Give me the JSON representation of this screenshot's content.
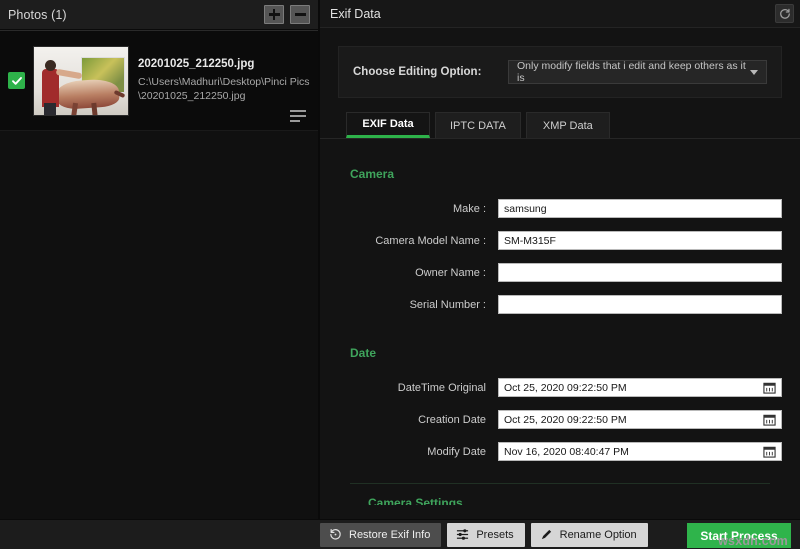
{
  "left_panel": {
    "title": "Photos (1)",
    "add_button": "add-photos-button",
    "remove_button": "remove-photos-button",
    "photo": {
      "name": "20201025_212250.jpg",
      "path": "C:\\Users\\Madhuri\\Desktop\\Pinci Pics\\20201025_212250.jpg",
      "checked": true
    }
  },
  "right_panel": {
    "title": "Exif Data",
    "refresh_icon": "refresh-icon",
    "editing_option": {
      "label": "Choose Editing Option:",
      "value": "Only modify fields that i edit and keep others as it is"
    },
    "tabs": [
      {
        "label": "EXIF Data",
        "active": true
      },
      {
        "label": "IPTC DATA",
        "active": false
      },
      {
        "label": "XMP Data",
        "active": false
      }
    ],
    "sections": [
      {
        "title": "Camera",
        "fields": [
          {
            "label": "Make :",
            "value": "samsung",
            "type": "text"
          },
          {
            "label": "Camera Model Name :",
            "value": "SM-M315F",
            "type": "text"
          },
          {
            "label": "Owner Name :",
            "value": "",
            "type": "text"
          },
          {
            "label": "Serial Number :",
            "value": "",
            "type": "text"
          }
        ]
      },
      {
        "title": "Date",
        "fields": [
          {
            "label": "DateTime Original",
            "value": "Oct 25, 2020 09:22:50 PM",
            "type": "date"
          },
          {
            "label": "Creation Date",
            "value": "Oct 25, 2020 09:22:50 PM",
            "type": "date"
          },
          {
            "label": "Modify Date",
            "value": "Nov 16, 2020 08:40:47 PM",
            "type": "date"
          }
        ]
      }
    ],
    "next_section_partial": "Camera Settings"
  },
  "bottom_bar": {
    "restore_exif_info": "Restore Exif Info",
    "presets": "Presets",
    "rename_option": "Rename Option",
    "start_process": "Start Process"
  },
  "watermark": "wsxdn.com",
  "colors": {
    "accent_green": "#2eb24a",
    "section_green": "#3fa45c",
    "panel_bg": "#131313",
    "input_bg": "#ffffff"
  }
}
